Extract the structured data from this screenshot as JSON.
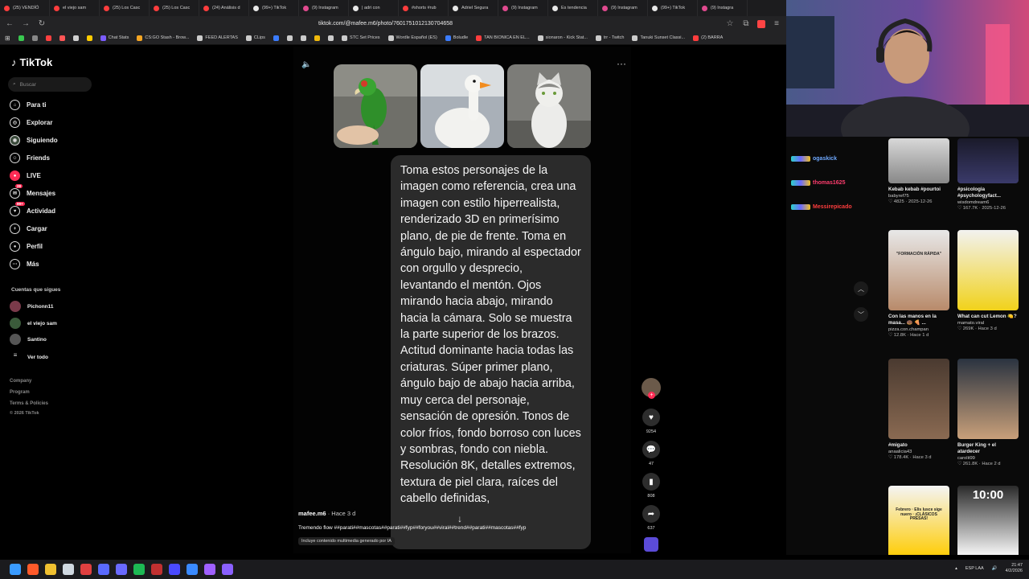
{
  "browser": {
    "tabs": [
      {
        "label": "(25) VENDÍÓ",
        "color": "#ff3d3d"
      },
      {
        "label": "el viejo sam ",
        "color": "#ff3d3d"
      },
      {
        "label": "(25) Los Casc",
        "color": "#ff3d3d"
      },
      {
        "label": "(25) Los Casc",
        "color": "#ff3d3d"
      },
      {
        "label": "(24) Análisis d",
        "color": "#ff3d3d"
      },
      {
        "label": "(99+) TikTok",
        "color": "#e8e8e8"
      },
      {
        "label": "(9) Instagram",
        "color": "#e14a8f"
      },
      {
        "label": "| adri con",
        "color": "#e8e8e8"
      },
      {
        "label": "#shorts #rub",
        "color": "#ff3d3d"
      },
      {
        "label": "Adriel Segura",
        "color": "#e8e8e8"
      },
      {
        "label": "(9) Instagram",
        "color": "#e14a8f"
      },
      {
        "label": "Es tendencia",
        "color": "#e8e8e8"
      },
      {
        "label": "(9) Instagram",
        "color": "#e14a8f"
      },
      {
        "label": "(99+) TikTok",
        "color": "#e8e8e8"
      },
      {
        "label": "(9) Instagra",
        "color": "#e14a8f"
      }
    ],
    "url": "tiktok.com/@mafee.m6/photo/7601751012130704658",
    "bookmarks": [
      {
        "label": "",
        "color": "#39c850"
      },
      {
        "label": "",
        "color": "#888"
      },
      {
        "label": "",
        "color": "#ff4040"
      },
      {
        "label": "",
        "color": "#ff5555"
      },
      {
        "label": "",
        "color": "#d0d0d0"
      },
      {
        "label": "",
        "color": "#ffcc00"
      },
      {
        "label": "Chat Stats",
        "color": "#7b5cff"
      },
      {
        "label": "CS:GO Stash - Brow...",
        "color": "#f5a623"
      },
      {
        "label": "FEED ALERTAS",
        "color": "#cccccc"
      },
      {
        "label": "CLips",
        "color": "#cccccc"
      },
      {
        "label": "",
        "color": "#3b7cff"
      },
      {
        "label": "",
        "color": "#cccccc"
      },
      {
        "label": "",
        "color": "#cccccc"
      },
      {
        "label": "",
        "color": "#f0b90b"
      },
      {
        "label": "",
        "color": "#cccccc"
      },
      {
        "label": "STC Set Prices",
        "color": "#cccccc"
      },
      {
        "label": "Wordle Español (ES)",
        "color": "#cccccc"
      },
      {
        "label": "Boludle",
        "color": "#3b7cff"
      },
      {
        "label": "TAN BIONICA EN EL...",
        "color": "#ff3d3d"
      },
      {
        "label": "sionaron - Kick Stat...",
        "color": "#cccccc"
      },
      {
        "label": "trr - Twitch",
        "color": "#cccccc"
      },
      {
        "label": "Tanuki Sunset Classi...",
        "color": "#cccccc"
      },
      {
        "label": "(2) BARRA",
        "color": "#ff3d3d"
      }
    ]
  },
  "tiktok": {
    "logo": "TikTok",
    "search_placeholder": "Buscar",
    "nav": [
      {
        "label": "Para ti",
        "icon": "home-icon"
      },
      {
        "label": "Explorar",
        "icon": "compass-icon"
      },
      {
        "label": "Siguiendo",
        "icon": "following-icon"
      },
      {
        "label": "Friends",
        "icon": "friends-icon"
      },
      {
        "label": "LIVE",
        "icon": "live-icon"
      },
      {
        "label": "Mensajes",
        "icon": "messages-icon",
        "badge": "28"
      },
      {
        "label": "Actividad",
        "icon": "activity-icon",
        "badge": "99+"
      },
      {
        "label": "Cargar",
        "icon": "upload-icon"
      },
      {
        "label": "Perfil",
        "icon": "profile-icon"
      },
      {
        "label": "Más",
        "icon": "more-icon"
      }
    ],
    "following_title": "Cuentas que sigues",
    "following": [
      "Pichonn11",
      "el viejo sam",
      "Santino",
      "Ver todo"
    ],
    "footer": [
      "Company",
      "Program",
      "Terms & Policies",
      "© 2026 TikTok"
    ],
    "post": {
      "text": "Toma estos personajes de la imagen como referencia, crea una imagen con estilo hiperrealista, renderizado 3D en primerísimo plano, de pie de frente. Toma en ángulo bajo, mirando al espectador con orgullo y desprecio, levantando el mentón. Ojos mirando hacia abajo, mirando hacia la cámara. Solo se muestra la parte superior de los brazos. Actitud dominante hacia todas las criaturas. Súper primer plano, ángulo bajo de abajo hacia arriba, muy cerca del personaje, sensación de opresión. Tonos de color fríos, fondo borroso con luces y sombras, fondo con niebla. Resolución 8K, detalles extremos, textura de piel clara, raíces del cabello definidas,",
      "author": "mafee.m6",
      "time": "· Hace 3 d",
      "caption": "Tremendo flow ##parati##mascotas##parati##fyp##foryou##viral##trend##parati##mascotas##fyp",
      "ai_label": "Incluye contenido multimedia generado por IA",
      "likes": "9254",
      "comments": "47",
      "saves": "808",
      "shares": "637"
    }
  },
  "chat": [
    {
      "user": "ogaskick",
      "color": "#6ea8ff"
    },
    {
      "user": "thomas1625",
      "color": "#ff3d6e"
    },
    {
      "user": "Messirepicado",
      "color": "#ff3d3d"
    }
  ],
  "related": [
    {
      "title": "Kebab kebab #pourtoi",
      "author": "babyref75",
      "stats": "♡ 4825 · 2025-12-26"
    },
    {
      "title": "#psicologia #psychologyfact...",
      "author": "wisdomdream6",
      "stats": "♡ 167.7K · 2025-12-26"
    },
    {
      "title": "Con las manos en la masa... 🍩 🍕 ...",
      "author": "pizza.con.champan",
      "stats": "♡ 12.8K · Hace 1 d",
      "overlay": "\"FORMACIÓN RÁPIDA\""
    },
    {
      "title": "What can cut Lemon 🍋?",
      "author": "mamato.viral",
      "stats": "♡ 269K · Hace 3 d"
    },
    {
      "title": "#migato",
      "author": "anaalicia43",
      "stats": "♡ 178.4K · Hace 3 d"
    },
    {
      "title": "Burger King + el atardecer",
      "author": "carolit99",
      "stats": "♡ 261.8K · Hace 2 d"
    },
    {
      "title": "",
      "author": "",
      "stats": "",
      "overlay": "Febrero · Elis lusce sige nuero · ¡CLÁSICOS PRESAS!"
    },
    {
      "title": "",
      "author": "",
      "stats": "",
      "overlay": "10:00"
    }
  ],
  "taskbar": {
    "lang": "ESP LAA",
    "time": "21:47",
    "date": "4/2/2026"
  }
}
